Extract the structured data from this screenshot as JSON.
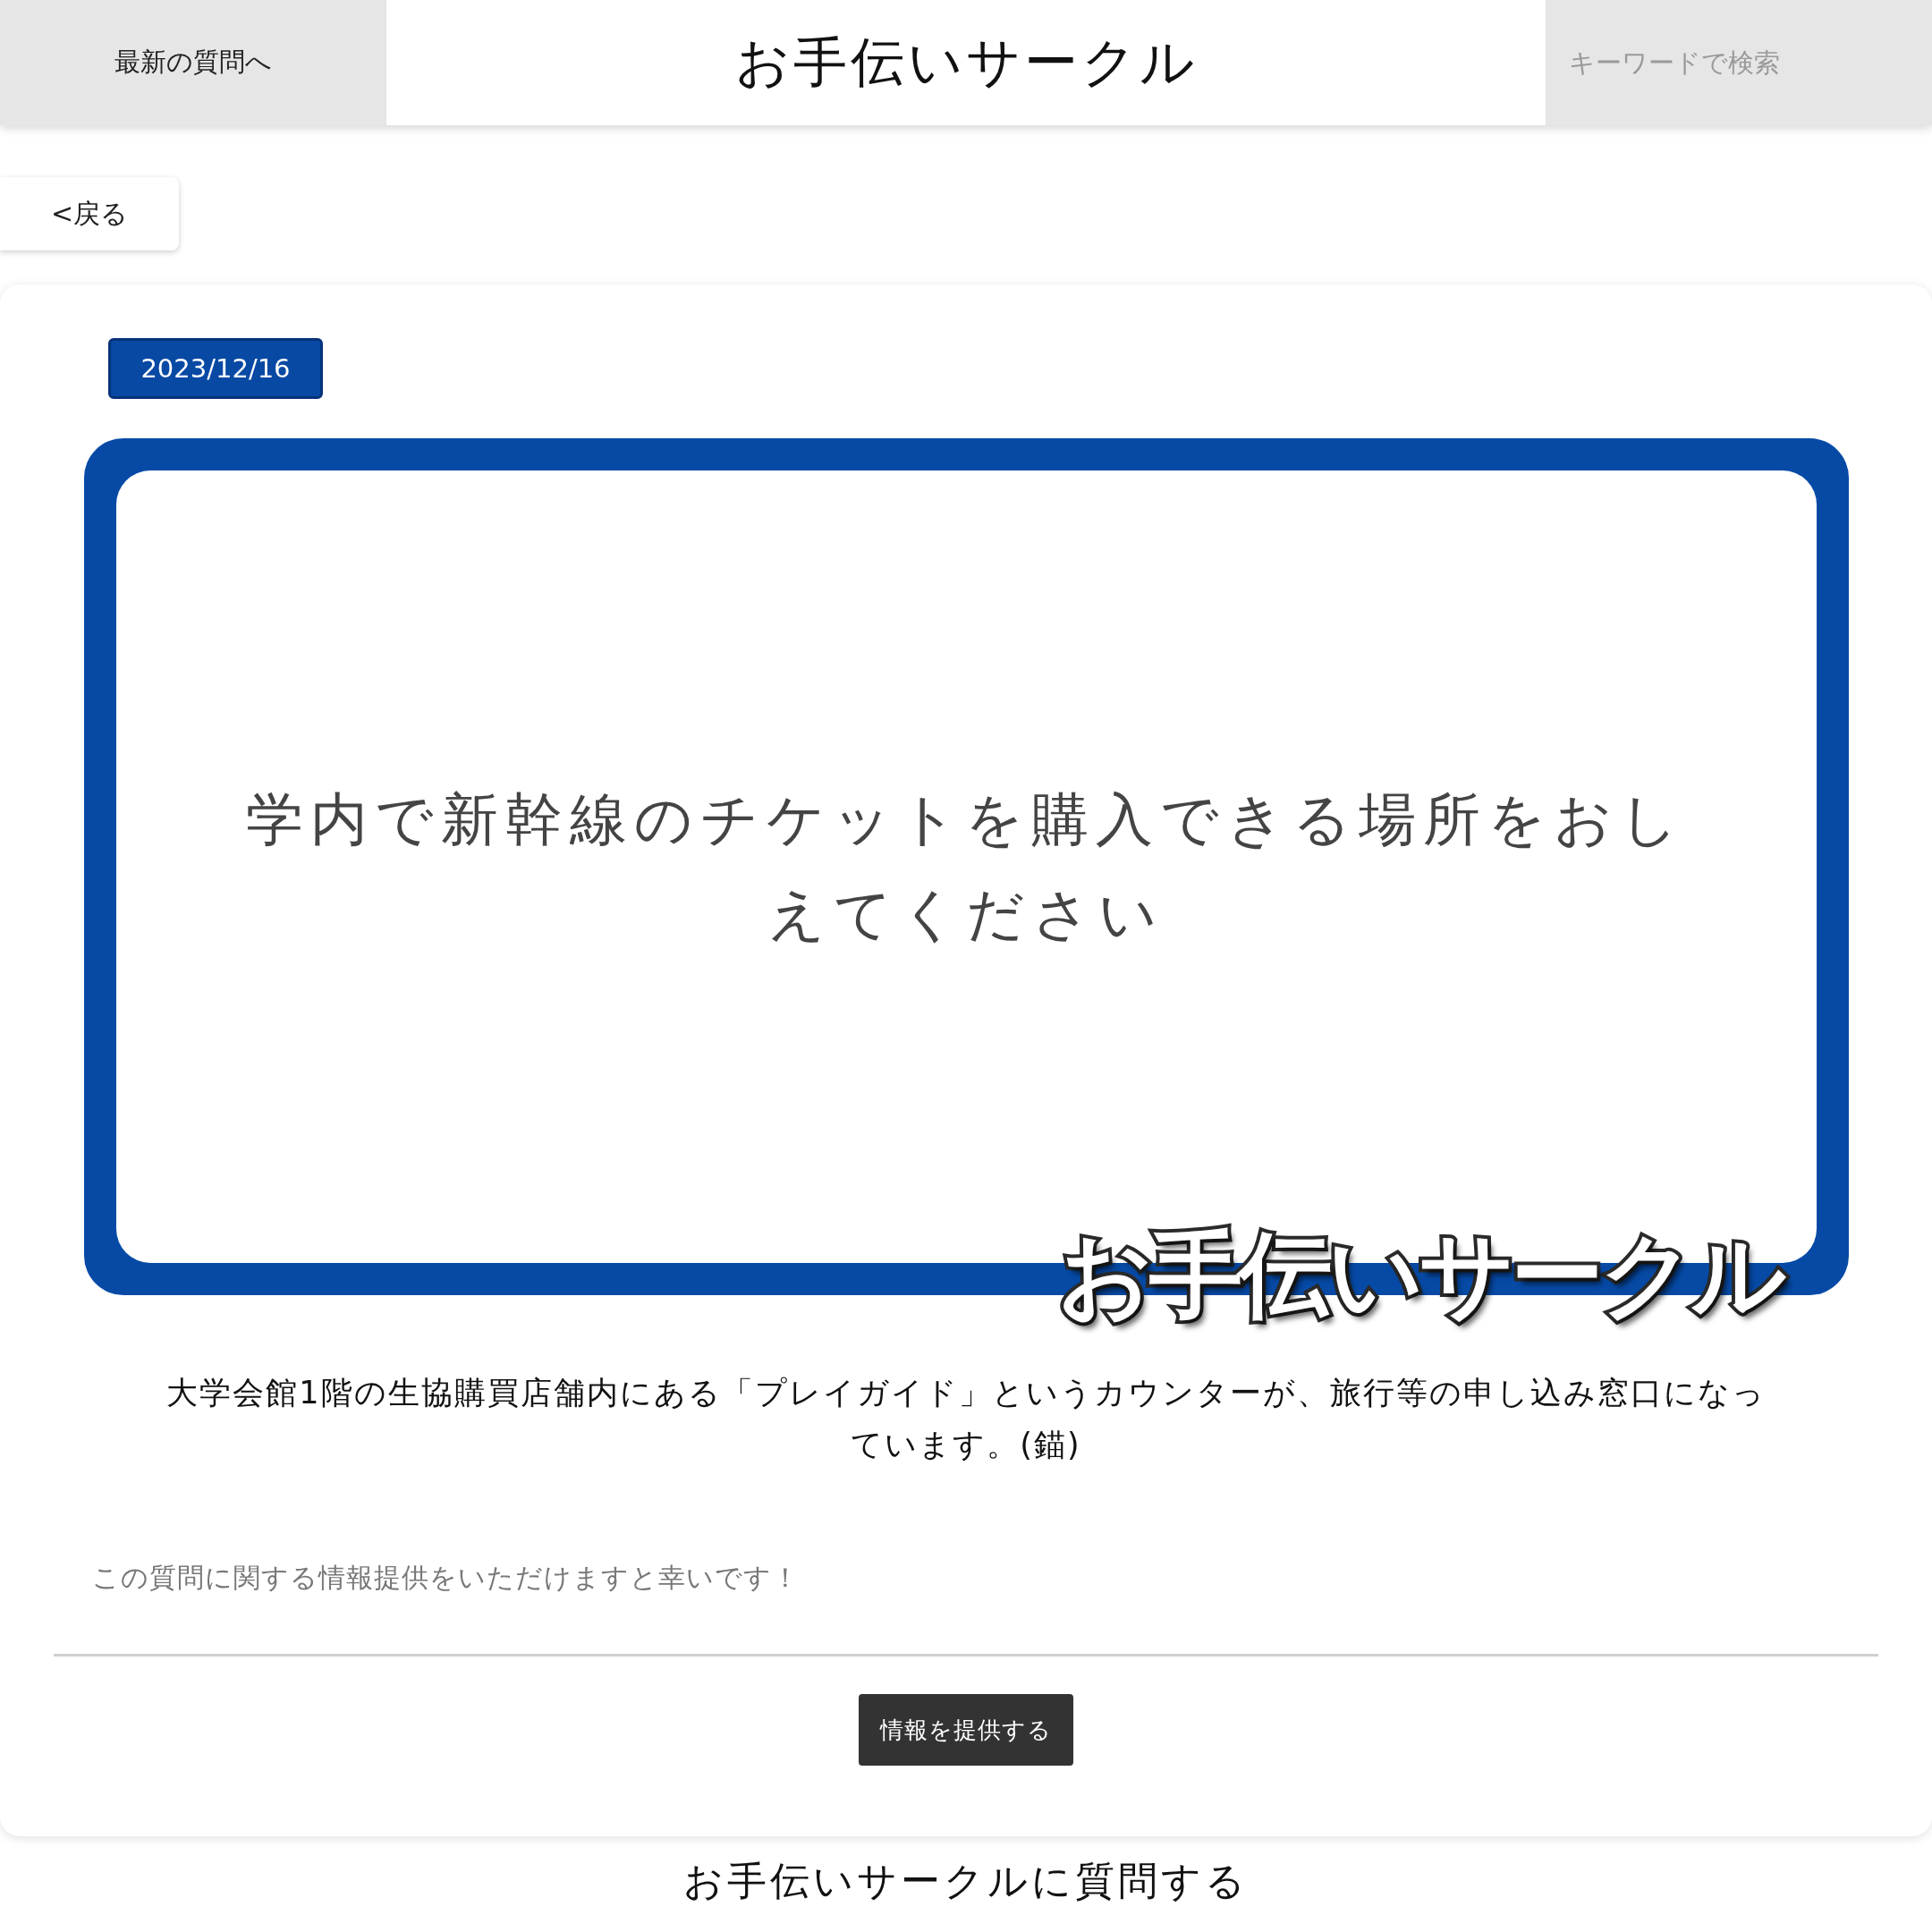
{
  "header": {
    "nav_link": "最新の質問へ",
    "site_title": "お手伝いサークル",
    "search": {
      "placeholder": "キーワードで検索"
    }
  },
  "back_button": "<戻る",
  "post": {
    "date": "2023/12/16",
    "image": {
      "question": "学内で新幹線のチケットを購入できる場所をおしえてください",
      "logo": "お手伝いサークル"
    },
    "answer": "大学会館1階の生協購買店舗内にある「プレイガイド」というカウンターが、旅行等の申し込み窓口になっています。(錨)",
    "note": "この質問に関する情報提供をいただけますと幸いです！",
    "provide_button": "情報を提供する"
  },
  "ask_heading": "お手伝いサークルに質問する"
}
